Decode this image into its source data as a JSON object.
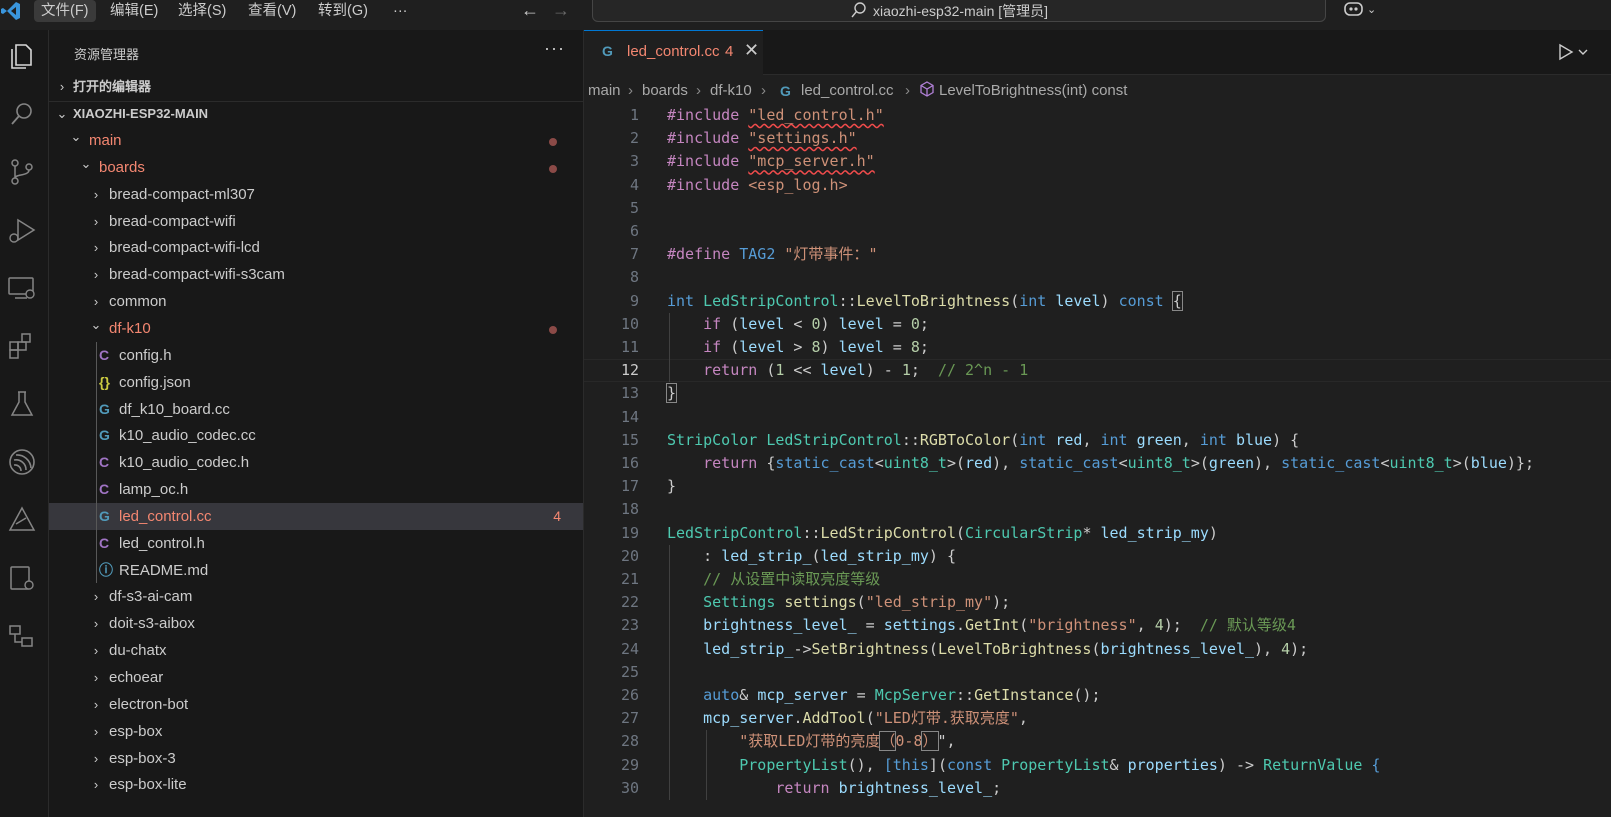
{
  "window": {
    "title": "xiaozhi-esp32-main [管理员]"
  },
  "menu": [
    "文件(F)",
    "编辑(E)",
    "选择(S)",
    "查看(V)",
    "转到(G)",
    "···"
  ],
  "copilot_icon": "copilot-icon",
  "activity_icons": [
    "explorer-icon",
    "search-icon",
    "source-control-icon",
    "run-debug-icon",
    "remote-explorer-icon",
    "extensions-icon",
    "testing-icon",
    "esp-idf-icon",
    "platformio-icon",
    "device-manager-icon",
    "flowchart-icon"
  ],
  "explorer": {
    "title": "资源管理器",
    "more": "···",
    "open_editors": "打开的编辑器",
    "workspace": "XIAOZHI-ESP32-MAIN",
    "tree": [
      {
        "label": "main",
        "type": "folder",
        "open": true,
        "indent": 1,
        "dot": true,
        "color": "#f48771"
      },
      {
        "label": "boards",
        "type": "folder",
        "open": true,
        "indent": 2,
        "dot": true,
        "color": "#f48771"
      },
      {
        "label": "bread-compact-ml307",
        "type": "folder",
        "open": false,
        "indent": 3,
        "color": "#cccccc"
      },
      {
        "label": "bread-compact-wifi",
        "type": "folder",
        "open": false,
        "indent": 3,
        "color": "#cccccc"
      },
      {
        "label": "bread-compact-wifi-lcd",
        "type": "folder",
        "open": false,
        "indent": 3,
        "color": "#cccccc"
      },
      {
        "label": "bread-compact-wifi-s3cam",
        "type": "folder",
        "open": false,
        "indent": 3,
        "color": "#cccccc"
      },
      {
        "label": "common",
        "type": "folder",
        "open": false,
        "indent": 3,
        "color": "#cccccc"
      },
      {
        "label": "df-k10",
        "type": "folder",
        "open": true,
        "indent": 3,
        "dot": true,
        "color": "#f48771"
      },
      {
        "label": "config.h",
        "type": "c",
        "indent": 4,
        "color": "#cccccc"
      },
      {
        "label": "config.json",
        "type": "json",
        "indent": 4,
        "color": "#cccccc"
      },
      {
        "label": "df_k10_board.cc",
        "type": "cpp",
        "indent": 4,
        "color": "#cccccc"
      },
      {
        "label": "k10_audio_codec.cc",
        "type": "cpp",
        "indent": 4,
        "color": "#cccccc"
      },
      {
        "label": "k10_audio_codec.h",
        "type": "c",
        "indent": 4,
        "color": "#cccccc"
      },
      {
        "label": "lamp_oc.h",
        "type": "c",
        "indent": 4,
        "color": "#cccccc"
      },
      {
        "label": "led_control.cc",
        "type": "cpp",
        "indent": 4,
        "color": "#f48771",
        "selected": true,
        "badge": "4"
      },
      {
        "label": "led_control.h",
        "type": "c",
        "indent": 4,
        "color": "#cccccc"
      },
      {
        "label": "README.md",
        "type": "info",
        "indent": 4,
        "color": "#cccccc"
      },
      {
        "label": "df-s3-ai-cam",
        "type": "folder",
        "open": false,
        "indent": 3,
        "color": "#cccccc"
      },
      {
        "label": "doit-s3-aibox",
        "type": "folder",
        "open": false,
        "indent": 3,
        "color": "#cccccc"
      },
      {
        "label": "du-chatx",
        "type": "folder",
        "open": false,
        "indent": 3,
        "color": "#cccccc"
      },
      {
        "label": "echoear",
        "type": "folder",
        "open": false,
        "indent": 3,
        "color": "#cccccc"
      },
      {
        "label": "electron-bot",
        "type": "folder",
        "open": false,
        "indent": 3,
        "color": "#cccccc"
      },
      {
        "label": "esp-box",
        "type": "folder",
        "open": false,
        "indent": 3,
        "color": "#cccccc"
      },
      {
        "label": "esp-box-3",
        "type": "folder",
        "open": false,
        "indent": 3,
        "color": "#cccccc"
      },
      {
        "label": "esp-box-lite",
        "type": "folder",
        "open": false,
        "indent": 3,
        "color": "#cccccc"
      }
    ]
  },
  "tab": {
    "name": "led_control.cc",
    "problems": "4",
    "close": "✕"
  },
  "breadcrumb": [
    "main",
    "boards",
    "df-k10",
    "led_control.cc",
    "LevelToBrightness(int) const"
  ],
  "current_line": 12,
  "code": [
    [
      [
        "#include",
        "k"
      ],
      [
        " ",
        ""
      ],
      [
        "\"led_control.h\"",
        "s sq"
      ]
    ],
    [
      [
        "#include",
        "k"
      ],
      [
        " ",
        ""
      ],
      [
        "\"settings.h\"",
        "s sq"
      ]
    ],
    [
      [
        "#include",
        "k"
      ],
      [
        " ",
        ""
      ],
      [
        "\"mcp_server.h\"",
        "s sq"
      ]
    ],
    [
      [
        "#include",
        "k"
      ],
      [
        " ",
        ""
      ],
      [
        "<esp_log.h>",
        "s"
      ]
    ],
    [],
    [],
    [
      [
        "#define",
        "k"
      ],
      [
        " ",
        ""
      ],
      [
        "TAG2",
        "t"
      ],
      [
        " ",
        ""
      ],
      [
        "\"灯带事件：\"",
        "s"
      ]
    ],
    [],
    [
      [
        "int",
        "t"
      ],
      [
        " ",
        ""
      ],
      [
        "LedStripControl",
        "ty"
      ],
      [
        "::",
        ""
      ],
      [
        "LevelToBrightness",
        "fn"
      ],
      [
        "(",
        ""
      ],
      [
        "int",
        "t"
      ],
      [
        " ",
        ""
      ],
      [
        "level",
        "v"
      ],
      [
        ") ",
        ""
      ],
      [
        "const",
        "t"
      ],
      [
        " ",
        ""
      ],
      [
        "{",
        "bm"
      ]
    ],
    [
      [
        "    ",
        ""
      ],
      [
        "if",
        "k"
      ],
      [
        " (",
        ""
      ],
      [
        "level",
        "v"
      ],
      [
        " < ",
        ""
      ],
      [
        "0",
        "n"
      ],
      [
        ") ",
        ""
      ],
      [
        "level",
        "v"
      ],
      [
        " = ",
        ""
      ],
      [
        "0",
        "n"
      ],
      [
        ";",
        ""
      ]
    ],
    [
      [
        "    ",
        ""
      ],
      [
        "if",
        "k"
      ],
      [
        " (",
        ""
      ],
      [
        "level",
        "v"
      ],
      [
        " > ",
        ""
      ],
      [
        "8",
        "n"
      ],
      [
        ") ",
        ""
      ],
      [
        "level",
        "v"
      ],
      [
        " = ",
        ""
      ],
      [
        "8",
        "n"
      ],
      [
        ";",
        ""
      ]
    ],
    [
      [
        "    ",
        ""
      ],
      [
        "return",
        "k"
      ],
      [
        " (",
        ""
      ],
      [
        "1",
        "n"
      ],
      [
        " << ",
        ""
      ],
      [
        "level",
        "v"
      ],
      [
        ") - ",
        ""
      ],
      [
        "1",
        "n"
      ],
      [
        ";  ",
        ""
      ],
      [
        "// 2^n - 1",
        "c"
      ]
    ],
    [
      [
        "}",
        "bm"
      ]
    ],
    [],
    [
      [
        "StripColor",
        "ty"
      ],
      [
        " ",
        ""
      ],
      [
        "LedStripControl",
        "ty"
      ],
      [
        "::",
        ""
      ],
      [
        "RGBToColor",
        "fn"
      ],
      [
        "(",
        ""
      ],
      [
        "int",
        "t"
      ],
      [
        " ",
        ""
      ],
      [
        "red",
        "v"
      ],
      [
        ", ",
        ""
      ],
      [
        "int",
        "t"
      ],
      [
        " ",
        ""
      ],
      [
        "green",
        "v"
      ],
      [
        ", ",
        ""
      ],
      [
        "int",
        "t"
      ],
      [
        " ",
        ""
      ],
      [
        "blue",
        "v"
      ],
      [
        ") {",
        ""
      ]
    ],
    [
      [
        "    ",
        ""
      ],
      [
        "return",
        "k"
      ],
      [
        " {",
        ""
      ],
      [
        "static_cast",
        "t"
      ],
      [
        "<",
        ""
      ],
      [
        "uint8_t",
        "ty"
      ],
      [
        ">(",
        ""
      ],
      [
        "red",
        "v"
      ],
      [
        "), ",
        ""
      ],
      [
        "static_cast",
        "t"
      ],
      [
        "<",
        ""
      ],
      [
        "uint8_t",
        "ty"
      ],
      [
        ">(",
        ""
      ],
      [
        "green",
        "v"
      ],
      [
        "), ",
        ""
      ],
      [
        "static_cast",
        "t"
      ],
      [
        "<",
        ""
      ],
      [
        "uint8_t",
        "ty"
      ],
      [
        ">(",
        ""
      ],
      [
        "blue",
        "v"
      ],
      [
        ")};",
        ""
      ]
    ],
    [
      [
        "}",
        ""
      ]
    ],
    [],
    [
      [
        "LedStripControl",
        "ty"
      ],
      [
        "::",
        ""
      ],
      [
        "LedStripControl",
        "fn"
      ],
      [
        "(",
        ""
      ],
      [
        "CircularStrip",
        "ty"
      ],
      [
        "* ",
        ""
      ],
      [
        "led_strip_my",
        "v"
      ],
      [
        ")",
        ""
      ]
    ],
    [
      [
        "    : ",
        ""
      ],
      [
        "led_strip_",
        "v"
      ],
      [
        "(",
        ""
      ],
      [
        "led_strip_my",
        "v"
      ],
      [
        ") {",
        ""
      ]
    ],
    [
      [
        "    ",
        ""
      ],
      [
        "// 从设置中读取亮度等级",
        "c"
      ]
    ],
    [
      [
        "    ",
        ""
      ],
      [
        "Settings",
        "ty"
      ],
      [
        " ",
        ""
      ],
      [
        "settings",
        "fn"
      ],
      [
        "(",
        ""
      ],
      [
        "\"led_strip_my\"",
        "s"
      ],
      [
        ");",
        ""
      ]
    ],
    [
      [
        "    ",
        ""
      ],
      [
        "brightness_level_",
        "v"
      ],
      [
        " = ",
        ""
      ],
      [
        "settings",
        "v"
      ],
      [
        ".",
        ""
      ],
      [
        "GetInt",
        "fn"
      ],
      [
        "(",
        ""
      ],
      [
        "\"brightness\"",
        "s"
      ],
      [
        ", ",
        ""
      ],
      [
        "4",
        "n"
      ],
      [
        ");  ",
        ""
      ],
      [
        "// 默认等级4",
        "c"
      ]
    ],
    [
      [
        "    ",
        ""
      ],
      [
        "led_strip_",
        "v"
      ],
      [
        "->",
        ""
      ],
      [
        "SetBrightness",
        "fn"
      ],
      [
        "(",
        ""
      ],
      [
        "LevelToBrightness",
        "fn"
      ],
      [
        "(",
        ""
      ],
      [
        "brightness_level_",
        "v"
      ],
      [
        "), ",
        ""
      ],
      [
        "4",
        "n"
      ],
      [
        ");",
        ""
      ]
    ],
    [],
    [
      [
        "    ",
        ""
      ],
      [
        "auto",
        "t"
      ],
      [
        "& ",
        ""
      ],
      [
        "mcp_server",
        "v"
      ],
      [
        " = ",
        ""
      ],
      [
        "McpServer",
        "ty"
      ],
      [
        "::",
        ""
      ],
      [
        "GetInstance",
        "fn"
      ],
      [
        "();",
        ""
      ]
    ],
    [
      [
        "    ",
        ""
      ],
      [
        "mcp_server",
        "v"
      ],
      [
        ".",
        ""
      ],
      [
        "AddTool",
        "fn"
      ],
      [
        "(",
        ""
      ],
      [
        "\"LED灯带.获取亮度\"",
        "s"
      ],
      [
        ",",
        ""
      ]
    ],
    [
      [
        "        ",
        ""
      ],
      [
        "\"获取LED灯带的亮度",
        "s"
      ],
      [
        "（",
        "s bm"
      ],
      [
        "0-8",
        "s"
      ],
      [
        "）",
        "s bm"
      ],
      [
        "\"",
        ""
      ],
      [
        ",",
        ""
      ]
    ],
    [
      [
        "        ",
        ""
      ],
      [
        "PropertyList",
        "ty"
      ],
      [
        "(), ",
        ""
      ],
      [
        "[",
        "t"
      ],
      [
        "this",
        "t"
      ],
      [
        "]",
        ""
      ],
      [
        "(",
        ""
      ],
      [
        "const",
        "t"
      ],
      [
        " ",
        ""
      ],
      [
        "PropertyList",
        "ty"
      ],
      [
        "& ",
        ""
      ],
      [
        "properties",
        "v"
      ],
      [
        ") -> ",
        ""
      ],
      [
        "ReturnValue",
        "ty"
      ],
      [
        " {",
        "t"
      ]
    ],
    [
      [
        "            ",
        ""
      ],
      [
        "return",
        "k"
      ],
      [
        " ",
        ""
      ],
      [
        "brightness_level_",
        "v"
      ],
      [
        ";",
        ""
      ]
    ]
  ]
}
